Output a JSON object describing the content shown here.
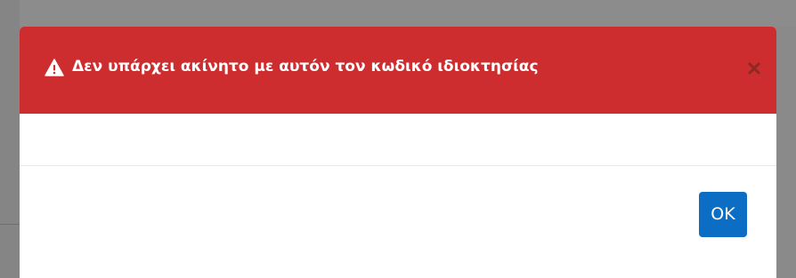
{
  "dialog": {
    "title": "Δεν υπάρχει ακίνητο με αυτόν τον κωδικό ιδιοκτησίας",
    "warning_icon": "warning-triangle-icon",
    "close_icon": "close-icon",
    "ok_label": "OK"
  },
  "colors": {
    "header_bg": "#cd2d2e",
    "ok_button_bg": "#0b6ec4",
    "backdrop": "#8a8a8a",
    "close_icon": "#8a2a22"
  }
}
